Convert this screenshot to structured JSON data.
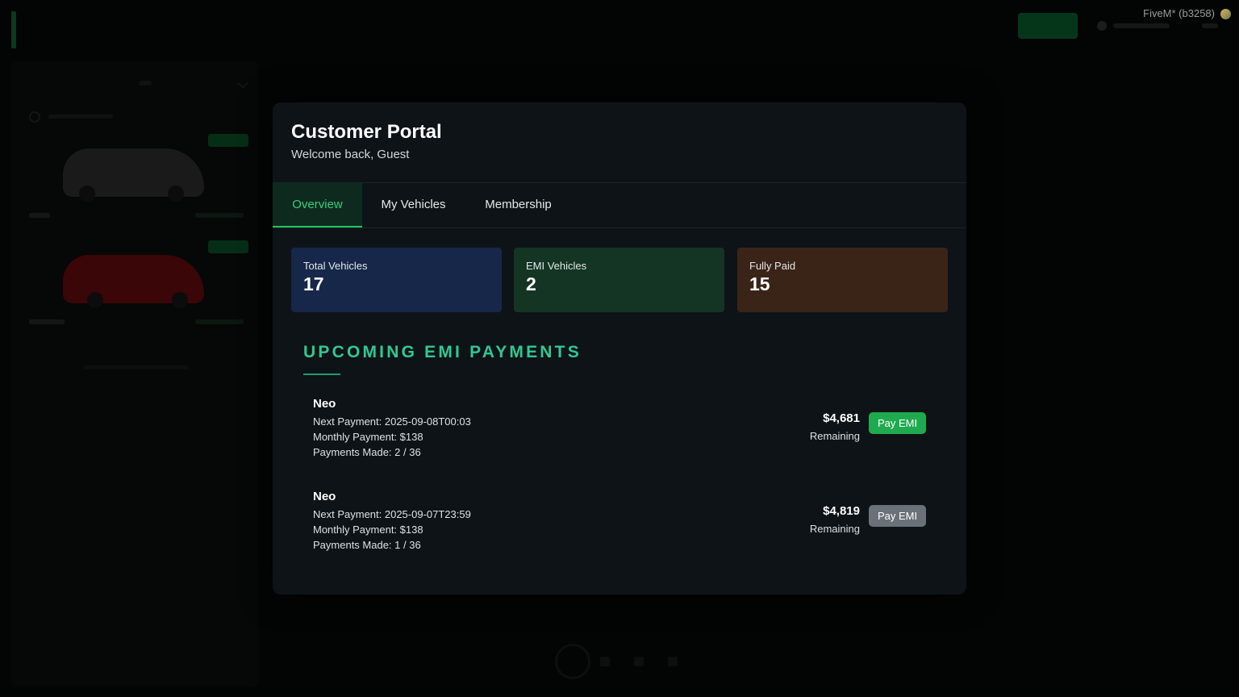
{
  "background_app": {
    "fivem_tag": "FiveM* (b3258)"
  },
  "modal": {
    "title": "Customer Portal",
    "subtitle": "Welcome back, Guest",
    "tabs": [
      {
        "label": "Overview",
        "active": true
      },
      {
        "label": "My Vehicles",
        "active": false
      },
      {
        "label": "Membership",
        "active": false
      }
    ],
    "stats": [
      {
        "label": "Total Vehicles",
        "value": "17",
        "color": "#16274a"
      },
      {
        "label": "EMI Vehicles",
        "value": "2",
        "color": "#143524"
      },
      {
        "label": "Fully Paid",
        "value": "15",
        "color": "#3a2418"
      }
    ],
    "section_title": "UPCOMING EMI PAYMENTS",
    "emi_payments": [
      {
        "name": "Neo",
        "next_payment": "Next Payment: 2025-09-08T00:03",
        "monthly_payment": "Monthly Payment: $138",
        "payments_made": "Payments Made: 2 / 36",
        "remaining_amount": "$4,681",
        "remaining_label": "Remaining",
        "button_label": "Pay EMI",
        "button_color": "#1faa4f",
        "button_state": "enabled"
      },
      {
        "name": "Neo",
        "next_payment": "Next Payment: 2025-09-07T23:59",
        "monthly_payment": "Monthly Payment: $138",
        "payments_made": "Payments Made: 1 / 36",
        "remaining_amount": "$4,819",
        "remaining_label": "Remaining",
        "button_label": "Pay EMI",
        "button_color": "#6b7178",
        "button_state": "disabled"
      }
    ]
  },
  "colors": {
    "accent_green": "#22c55e",
    "section_title": "#2fc991",
    "modal_bg": "#0d1317"
  }
}
